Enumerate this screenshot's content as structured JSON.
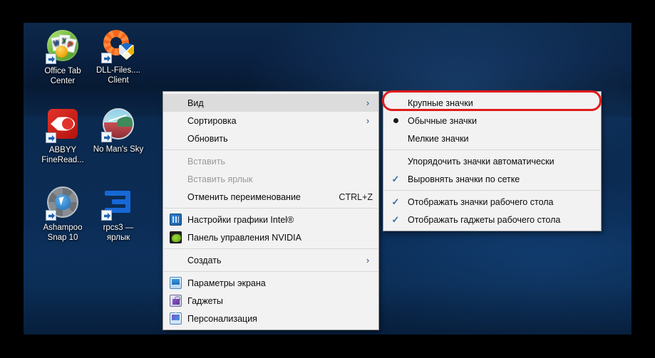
{
  "desktop": {
    "icons": [
      {
        "name": "Office Tab Center",
        "lines": [
          "Office Tab",
          "Center"
        ],
        "art": "office"
      },
      {
        "name": "DLL-Files.... Client",
        "lines": [
          "DLL-Files....",
          "Client"
        ],
        "art": "dll"
      },
      {
        "name": "ABBYY FineRead...",
        "lines": [
          "ABBYY",
          "FineRead..."
        ],
        "art": "abbyy"
      },
      {
        "name": "No Man's Sky",
        "lines": [
          "No Man's Sky",
          ""
        ],
        "art": "nms"
      },
      {
        "name": "Ashampoo Snap 10",
        "lines": [
          "Ashampoo",
          "Snap 10"
        ],
        "art": "ash"
      },
      {
        "name": "rpcs3 — ярлык",
        "lines": [
          "rpcs3 —",
          "ярлык"
        ],
        "art": "rpcs3"
      }
    ]
  },
  "context_menu": {
    "items": [
      {
        "label": "Вид",
        "icon": "",
        "arrow": "›",
        "accel": "",
        "state": "highlighted"
      },
      {
        "label": "Сортировка",
        "icon": "",
        "arrow": "›",
        "accel": "",
        "state": "normal"
      },
      {
        "label": "Обновить",
        "icon": "",
        "arrow": "",
        "accel": "",
        "state": "normal"
      },
      {
        "label": "__sep__"
      },
      {
        "label": "Вставить",
        "icon": "",
        "arrow": "",
        "accel": "",
        "state": "disabled"
      },
      {
        "label": "Вставить ярлык",
        "icon": "",
        "arrow": "",
        "accel": "",
        "state": "disabled"
      },
      {
        "label": "Отменить переименование",
        "icon": "",
        "arrow": "",
        "accel": "CTRL+Z",
        "state": "normal"
      },
      {
        "label": "__sep__"
      },
      {
        "label": "Настройки графики Intel®",
        "icon": "intel-graphics-icon",
        "arrow": "",
        "accel": "",
        "state": "normal"
      },
      {
        "label": "Панель управления NVIDIA",
        "icon": "nvidia-icon",
        "arrow": "",
        "accel": "",
        "state": "normal"
      },
      {
        "label": "__sep__"
      },
      {
        "label": "Создать",
        "icon": "",
        "arrow": "›",
        "accel": "",
        "state": "normal"
      },
      {
        "label": "__sep__"
      },
      {
        "label": "Параметры экрана",
        "icon": "display-settings-icon",
        "arrow": "",
        "accel": "",
        "state": "normal"
      },
      {
        "label": "Гаджеты",
        "icon": "gadgets-icon",
        "arrow": "",
        "accel": "",
        "state": "normal"
      },
      {
        "label": "Персонализация",
        "icon": "personalization-icon",
        "arrow": "",
        "accel": "",
        "state": "normal"
      }
    ]
  },
  "view_submenu": {
    "items": [
      {
        "label": "Крупные значки",
        "mark": "none",
        "state": "normal"
      },
      {
        "label": "Обычные значки",
        "mark": "radio",
        "state": "normal"
      },
      {
        "label": "Мелкие значки",
        "mark": "none",
        "state": "normal"
      },
      {
        "label": "__sep__"
      },
      {
        "label": "Упорядочить значки автоматически",
        "mark": "none",
        "state": "normal"
      },
      {
        "label": "Выровнять значки по сетке",
        "mark": "check",
        "state": "normal"
      },
      {
        "label": "__sep__"
      },
      {
        "label": "Отображать значки рабочего стола",
        "mark": "check",
        "state": "normal"
      },
      {
        "label": "Отображать гаджеты  рабочего стола",
        "mark": "check",
        "state": "normal"
      }
    ]
  },
  "annotation": {
    "highlight_target": "Крупные значки",
    "color": "#e01b1b"
  }
}
